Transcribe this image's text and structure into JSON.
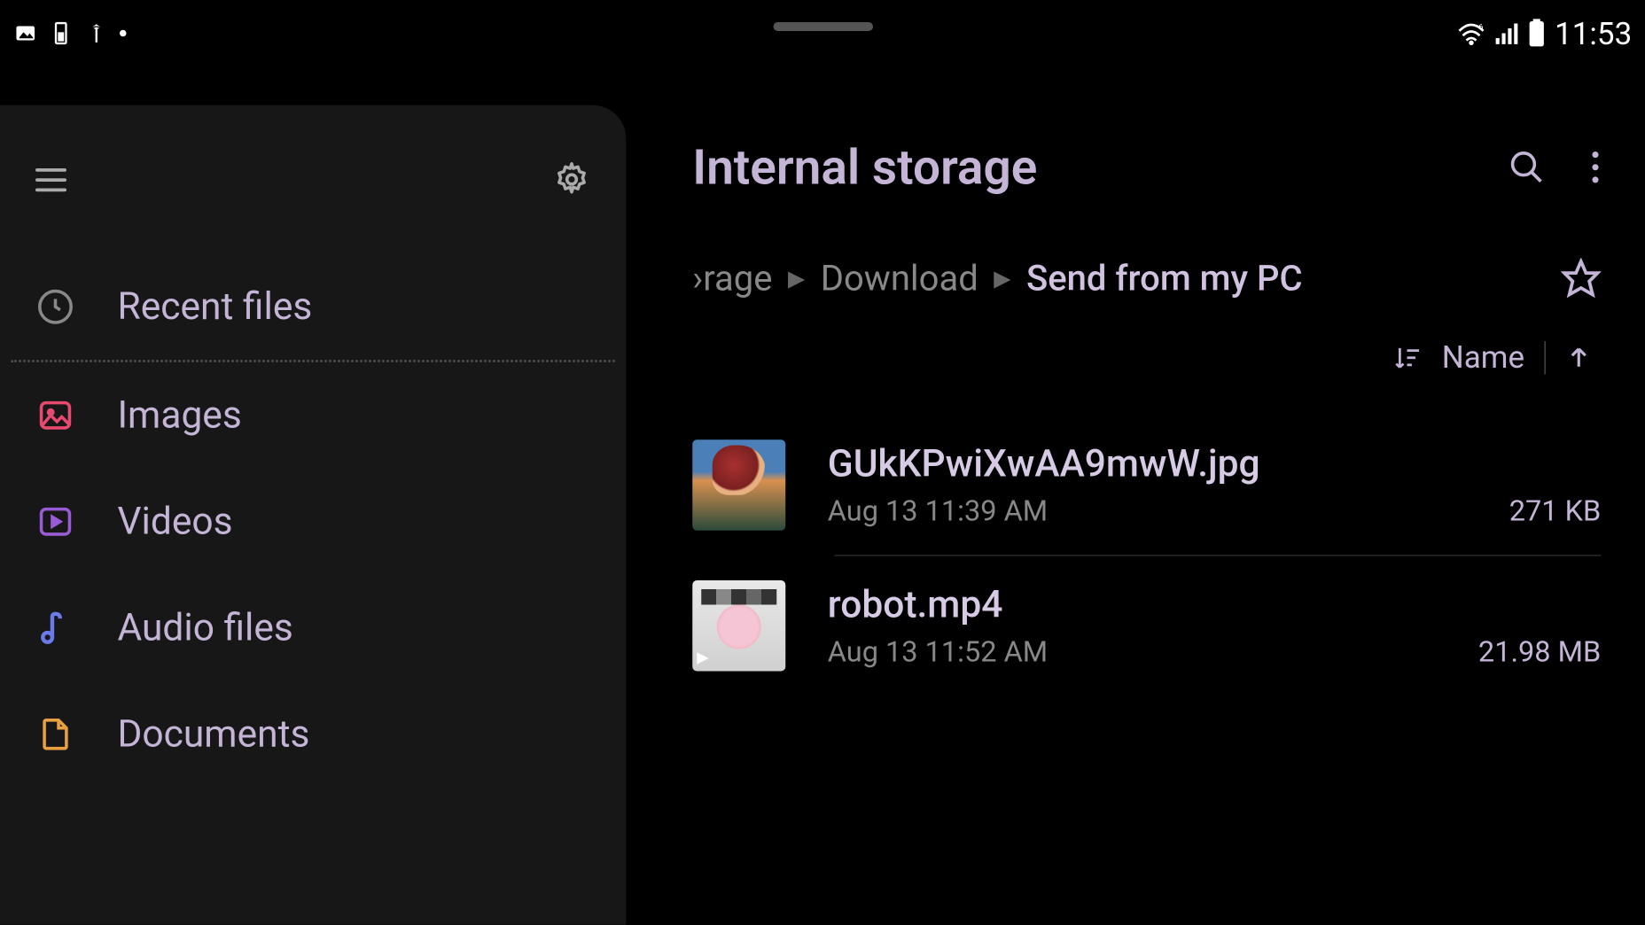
{
  "status": {
    "time": "11:53"
  },
  "sidebar": {
    "items": [
      {
        "label": "Recent files"
      },
      {
        "label": "Images"
      },
      {
        "label": "Videos"
      },
      {
        "label": "Audio files"
      },
      {
        "label": "Documents"
      }
    ]
  },
  "header": {
    "title": "Internal storage"
  },
  "breadcrumb": {
    "part0": "›rage",
    "part1": "Download",
    "current": "Send from my PC"
  },
  "sort": {
    "label": "Name"
  },
  "files": [
    {
      "name": "GUkKPwiXwAA9mwW.jpg",
      "date": "Aug 13 11:39 AM",
      "size": "271 KB"
    },
    {
      "name": "robot.mp4",
      "date": "Aug 13 11:52 AM",
      "size": "21.98 MB"
    }
  ],
  "colors": {
    "images": "#e84a6f",
    "videos": "#9a5cd6",
    "audio": "#6a7ae8",
    "documents": "#e8a040"
  }
}
